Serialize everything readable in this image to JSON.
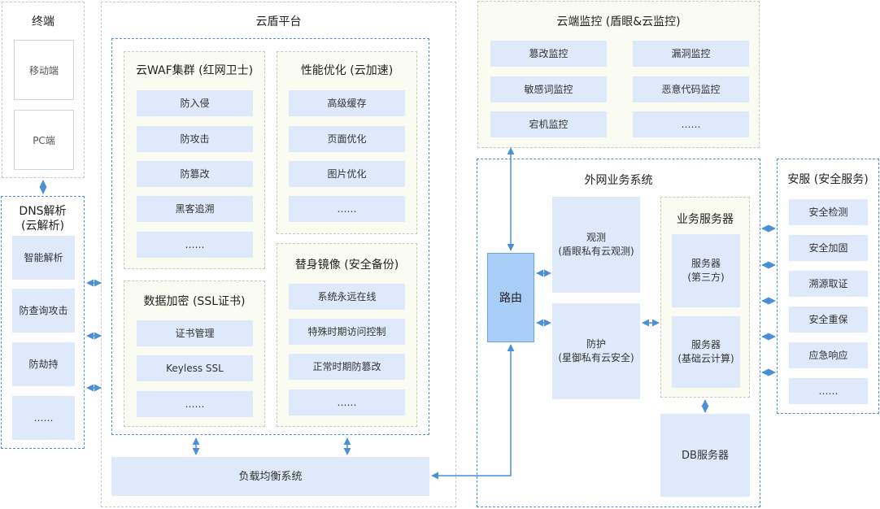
{
  "terminal": {
    "title": "终端",
    "items": [
      "移动端",
      "PC端"
    ]
  },
  "dns": {
    "title_line1": "DNS解析",
    "title_line2": "(云解析)",
    "items": [
      "智能解析",
      "防查询攻击",
      "防劫持",
      "……"
    ]
  },
  "shield": {
    "title": "云盾平台",
    "waf": {
      "title": "云WAF集群 (红网卫士)",
      "items": [
        "防入侵",
        "防攻击",
        "防篡改",
        "黑客追溯",
        "……"
      ]
    },
    "perf": {
      "title": "性能优化 (云加速)",
      "items": [
        "高级缓存",
        "页面优化",
        "图片优化",
        "……"
      ]
    },
    "ssl": {
      "title": "数据加密 (SSL证书)",
      "items": [
        "证书管理",
        "Keyless SSL",
        "……"
      ]
    },
    "mirror": {
      "title": "替身镜像 (安全备份)",
      "items": [
        "系统永远在线",
        "特殊时期访问控制",
        "正常时期防篡改",
        "……"
      ]
    },
    "lb": "负载均衡系统"
  },
  "monitor": {
    "title": "云端监控 (盾眼&云监控)",
    "items": [
      "篡改监控",
      "漏洞监控",
      "敏感词监控",
      "恶意代码监控",
      "宕机监控",
      "……"
    ]
  },
  "business": {
    "title": "外网业务系统",
    "router": "路由",
    "observe": {
      "line1": "观测",
      "line2": "(盾眼私有云观测)"
    },
    "protect": {
      "line1": "防护",
      "line2": "(星御私有云安全)"
    },
    "servers": {
      "title": "业务服务器",
      "s1": {
        "line1": "服务器",
        "line2": "(第三方)"
      },
      "s2": {
        "line1": "服务器",
        "line2": "(基础云计算)"
      }
    },
    "db": "DB服务器"
  },
  "service": {
    "title": "安服 (安全服务)",
    "items": [
      "安全检测",
      "安全加固",
      "溯源取证",
      "安全重保",
      "应急响应",
      "……"
    ]
  },
  "colors": {
    "accent": "#4a90d9",
    "cell": "#deeafb",
    "router": "#a8cdf7",
    "panel": "#fbfcf1"
  }
}
